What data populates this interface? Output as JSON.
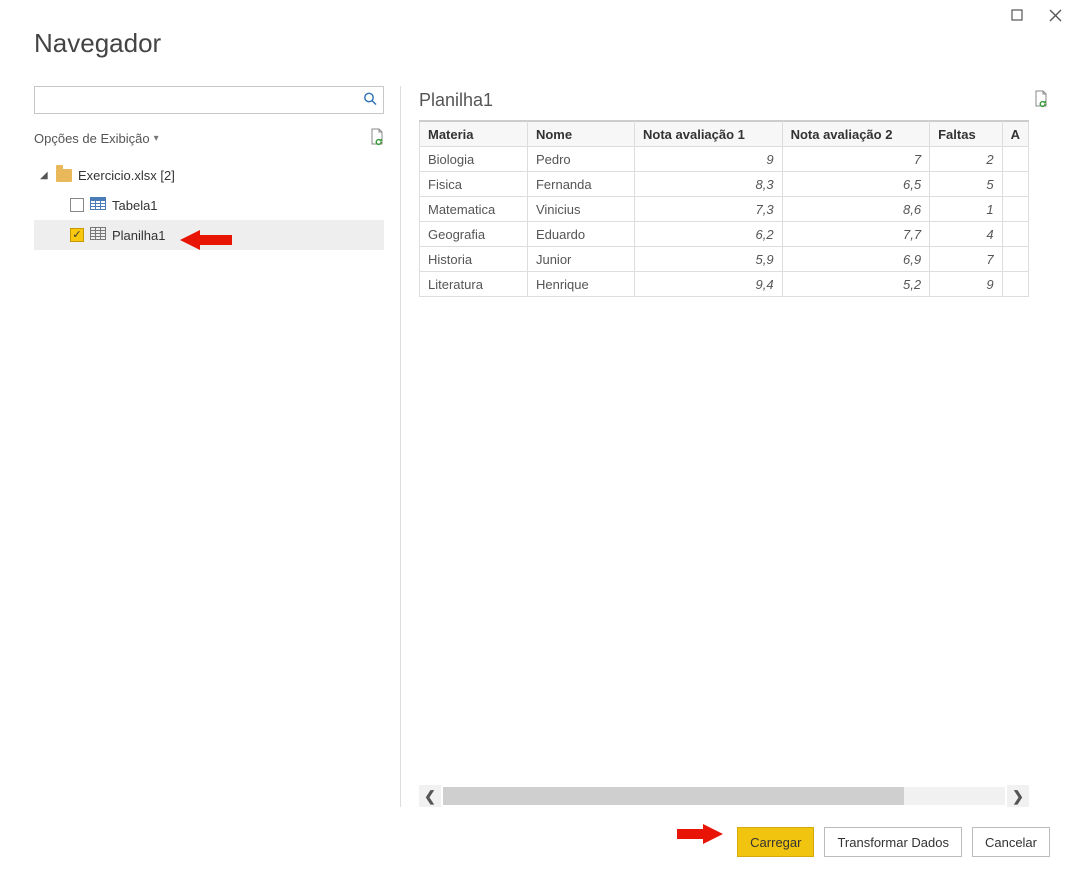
{
  "dialog": {
    "title": "Navegador"
  },
  "search": {
    "value": "",
    "placeholder": ""
  },
  "display_options": {
    "label": "Opções de Exibição"
  },
  "tree": {
    "file_label": "Exercicio.xlsx [2]",
    "items": [
      {
        "label": "Tabela1",
        "checked": false
      },
      {
        "label": "Planilha1",
        "checked": true
      }
    ]
  },
  "preview": {
    "title": "Planilha1",
    "columns": [
      "Materia",
      "Nome",
      "Nota avaliação 1",
      "Nota avaliação 2",
      "Faltas",
      "A"
    ],
    "rows": [
      {
        "materia": "Biologia",
        "nome": "Pedro",
        "n1": "9",
        "n2": "7",
        "faltas": "2"
      },
      {
        "materia": "Fisica",
        "nome": "Fernanda",
        "n1": "8,3",
        "n2": "6,5",
        "faltas": "5"
      },
      {
        "materia": "Matematica",
        "nome": "Vinicius",
        "n1": "7,3",
        "n2": "8,6",
        "faltas": "1"
      },
      {
        "materia": "Geografia",
        "nome": "Eduardo",
        "n1": "6,2",
        "n2": "7,7",
        "faltas": "4"
      },
      {
        "materia": "Historia",
        "nome": "Junior",
        "n1": "5,9",
        "n2": "6,9",
        "faltas": "7"
      },
      {
        "materia": "Literatura",
        "nome": "Henrique",
        "n1": "9,4",
        "n2": "5,2",
        "faltas": "9"
      }
    ]
  },
  "footer": {
    "load": "Carregar",
    "transform": "Transformar Dados",
    "cancel": "Cancelar"
  }
}
